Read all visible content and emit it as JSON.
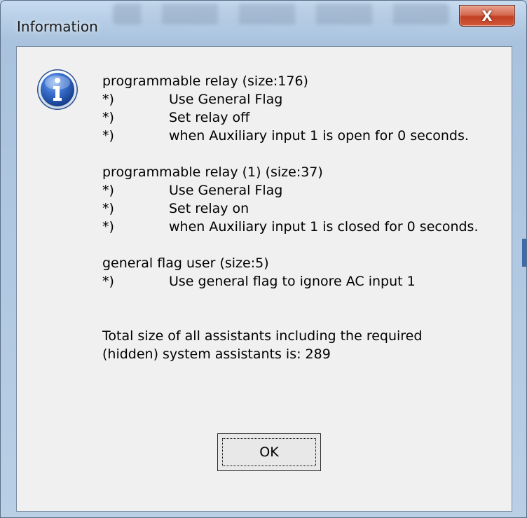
{
  "window": {
    "title": "Information",
    "close_label": "X"
  },
  "icon": "information-icon",
  "message": {
    "blocks": [
      {
        "heading": "programmable relay (size:176)",
        "items": [
          {
            "bullet": "*)",
            "text": "Use General Flag"
          },
          {
            "bullet": "*)",
            "text": "Set relay off"
          },
          {
            "bullet": "*)",
            "text": "when Auxiliary input 1 is open for 0 seconds."
          }
        ]
      },
      {
        "heading": "programmable relay (1) (size:37)",
        "items": [
          {
            "bullet": "*)",
            "text": "Use General Flag"
          },
          {
            "bullet": "*)",
            "text": "Set relay on"
          },
          {
            "bullet": "*)",
            "text": "when Auxiliary input 1 is closed for 0 seconds."
          }
        ]
      },
      {
        "heading": "general flag user (size:5)",
        "items": [
          {
            "bullet": "*)",
            "text": "Use general flag to ignore AC input 1"
          }
        ]
      }
    ],
    "total_line1": "Total size of all assistants including the required",
    "total_line2": "(hidden) system assistants is: 289"
  },
  "buttons": {
    "ok_label": "OK"
  },
  "colors": {
    "close_button": "#c94a2d",
    "client_bg": "#f0f0f0",
    "icon_blue": "#1f4fa6"
  }
}
